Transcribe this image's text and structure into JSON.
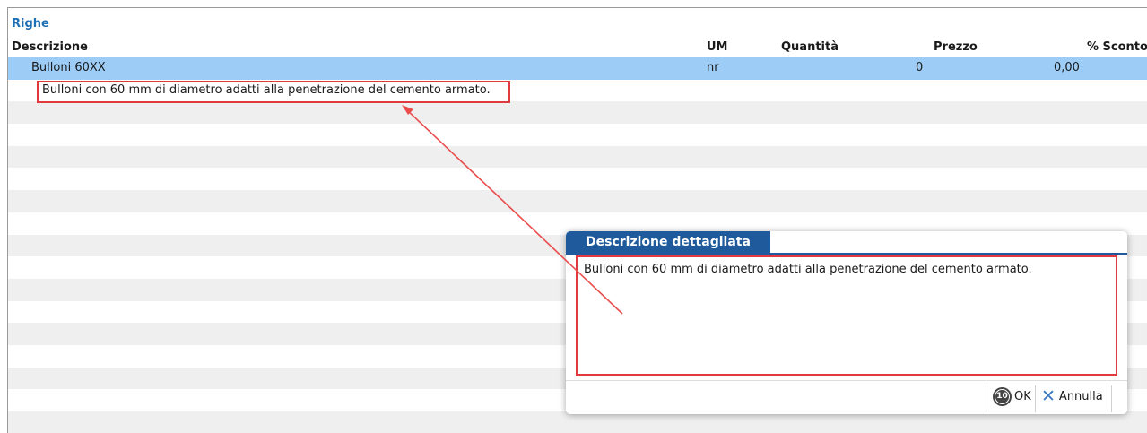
{
  "section": {
    "title": "Righe"
  },
  "columns": {
    "descrizione": "Descrizione",
    "um": "UM",
    "quantita": "Quantità",
    "prezzo": "Prezzo",
    "sconto": "% Sconto"
  },
  "rows": [
    {
      "descrizione": "Bulloni 60XX",
      "um": "nr",
      "quantita": "0",
      "prezzo": "0,00",
      "selected": true
    },
    {
      "descrizione": "Bulloni con 60 mm di diametro adatti alla penetrazione del cemento armato."
    }
  ],
  "dialog": {
    "title": "Descrizione dettagliata",
    "text": "Bulloni con 60 mm di diametro adatti alla penetrazione del cemento armato.",
    "ok_key": "10",
    "ok_label": "OK",
    "cancel_label": "Annulla"
  },
  "icons": {
    "ok": "f10-key-icon",
    "cancel": "close-x-icon"
  },
  "colors": {
    "accent": "#1e5a9c",
    "selection": "#9dccf6",
    "highlight": "#e0393e",
    "title": "#1f6fb5"
  }
}
